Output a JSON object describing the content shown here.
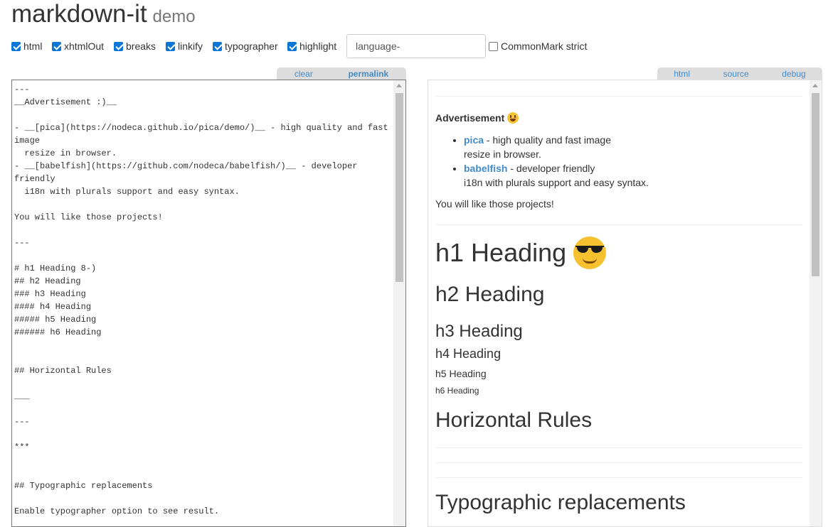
{
  "header": {
    "title": "markdown-it",
    "subtitle": "demo"
  },
  "options": {
    "checkboxes": [
      {
        "label": "html",
        "checked": true
      },
      {
        "label": "xhtmlOut",
        "checked": true
      },
      {
        "label": "breaks",
        "checked": true
      },
      {
        "label": "linkify",
        "checked": true
      },
      {
        "label": "typographer",
        "checked": true
      },
      {
        "label": "highlight",
        "checked": true
      }
    ],
    "language_placeholder": "language-",
    "commonmark": {
      "label": "CommonMark strict",
      "checked": false
    }
  },
  "source_tabs": {
    "clear": "clear",
    "permalink": "permalink"
  },
  "result_tabs": {
    "html": "html",
    "source": "source",
    "debug": "debug"
  },
  "source_text": "---\n__Advertisement :)__\n\n- __[pica](https://nodeca.github.io/pica/demo/)__ - high quality and fast\nimage\n  resize in browser.\n- __[babelfish](https://github.com/nodeca/babelfish/)__ - developer\nfriendly\n  i18n with plurals support and easy syntax.\n\nYou will like those projects!\n\n---\n\n# h1 Heading 8-)\n## h2 Heading\n### h3 Heading\n#### h4 Heading\n##### h5 Heading\n###### h6 Heading\n\n\n## Horizontal Rules\n\n___\n\n---\n\n***\n\n\n## Typographic replacements\n\nEnable typographer option to see result.",
  "result": {
    "ad_title": "Advertisement",
    "items": [
      {
        "link": "pica",
        "text": " - high quality and fast image",
        "line2": "resize in browser."
      },
      {
        "link": "babelfish",
        "text": " - developer friendly",
        "line2": "i18n with plurals support and easy syntax."
      }
    ],
    "paragraph": "You will like those projects!",
    "h1": "h1 Heading",
    "h2": "h2 Heading",
    "h3": "h3 Heading",
    "h4": "h4 Heading",
    "h5": "h5 Heading",
    "h6": "h6 Heading",
    "horizontal_rules": "Horizontal Rules",
    "typographic": "Typographic replacements"
  },
  "colors": {
    "link": "#428bca",
    "tabbar": "#dddddd",
    "checkbox": "#0b76d6"
  }
}
